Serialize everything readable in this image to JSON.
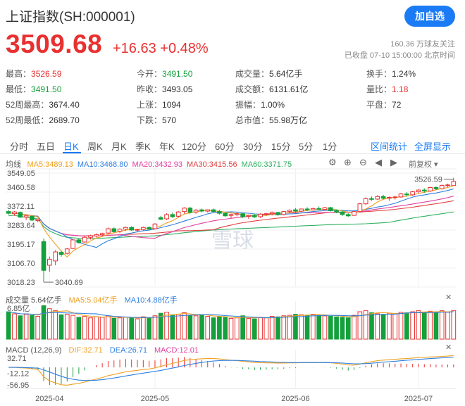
{
  "header": {
    "title": "上证指数(SH:000001)",
    "add_button": "加自选",
    "price": "3509.68",
    "change": "+16.63 +0.48%",
    "followers": "160.36 万球友关注",
    "status": "已收盘 07-10 15:00:00 北京时间"
  },
  "stats": [
    {
      "label": "最高：",
      "value": "3526.59",
      "color": "red"
    },
    {
      "label": "今开：",
      "value": "3491.50",
      "color": "green"
    },
    {
      "label": "成交量：",
      "value": "5.64亿手",
      "color": ""
    },
    {
      "label": "换手：",
      "value": "1.24%",
      "color": ""
    },
    {
      "label": "最低：",
      "value": "3491.50",
      "color": "green"
    },
    {
      "label": "昨收：",
      "value": "3493.05",
      "color": ""
    },
    {
      "label": "成交额：",
      "value": "6131.61亿",
      "color": ""
    },
    {
      "label": "量比：",
      "value": "1.18",
      "color": "red"
    },
    {
      "label": "52周最高：",
      "value": "3674.40",
      "color": ""
    },
    {
      "label": "上涨：",
      "value": "1094",
      "color": ""
    },
    {
      "label": "振幅：",
      "value": "1.00%",
      "color": ""
    },
    {
      "label": "平盘：",
      "value": "72",
      "color": ""
    },
    {
      "label": "52周最低：",
      "value": "2689.70",
      "color": ""
    },
    {
      "label": "下跌：",
      "value": "570",
      "color": ""
    },
    {
      "label": "总市值：",
      "value": "55.98万亿",
      "color": ""
    }
  ],
  "tabs": [
    "分时",
    "五日",
    "日K",
    "周K",
    "月K",
    "季K",
    "年K",
    "120分",
    "60分",
    "30分",
    "15分",
    "5分",
    "1分"
  ],
  "active_tab": "日K",
  "tab_links": [
    "区间统计",
    "全屏显示"
  ],
  "chart_controls": {
    "avg_label": "均线",
    "adjust": "前复权",
    "watermark": "雪球"
  },
  "colors": {
    "up": "#e93030",
    "down": "#14a03c",
    "ma5": "#f0a020",
    "ma10": "#2f7fe0",
    "ma20": "#e040a0",
    "ma30": "#e04040",
    "ma60": "#30b060",
    "accent": "#1a7bf5"
  },
  "ma_legend": [
    {
      "text": "MA5:3489.13",
      "color": "#f0a020"
    },
    {
      "text": "MA10:3468.80",
      "color": "#2f7fe0"
    },
    {
      "text": "MA20:3432.93",
      "color": "#e040a0"
    },
    {
      "text": "MA30:3415.56",
      "color": "#e04040"
    },
    {
      "text": "MA60:3371.75",
      "color": "#30b060"
    }
  ],
  "volume_legend": [
    {
      "text": "成交量 5.64亿手",
      "color": "#555555"
    },
    {
      "text": "MA5:5.04亿手",
      "color": "#f0a020"
    },
    {
      "text": "MA10:4.88亿手",
      "color": "#2f7fe0"
    }
  ],
  "macd_legend": [
    {
      "text": "MACD (12,26,9)",
      "color": "#555555"
    },
    {
      "text": "DIF:32.71",
      "color": "#f0a020"
    },
    {
      "text": "DEA:26.71",
      "color": "#2f7fe0"
    },
    {
      "text": "MACD:12.01",
      "color": "#e040a0"
    }
  ],
  "chart_data": {
    "type": "candlestick",
    "price_axis": {
      "min": 3018.23,
      "max": 3549.05,
      "ticks": [
        "3549.05",
        "3460.58",
        "3372.11",
        "3283.64",
        "3195.17",
        "3106.70",
        "3018.23"
      ]
    },
    "annotations": {
      "high": "3526.59",
      "low": "3040.69"
    },
    "x_labels": [
      {
        "label": "2025-04",
        "index": 7
      },
      {
        "label": "2025-05",
        "index": 25
      },
      {
        "label": "2025-06",
        "index": 49
      },
      {
        "label": "2025-07",
        "index": 70
      }
    ],
    "candles": [
      [
        3370,
        3378,
        3355,
        3362
      ],
      [
        3360,
        3372,
        3350,
        3368
      ],
      [
        3366,
        3370,
        3340,
        3344
      ],
      [
        3344,
        3352,
        3330,
        3350
      ],
      [
        3348,
        3350,
        3325,
        3330
      ],
      [
        3328,
        3336,
        3320,
        3334
      ],
      [
        3230,
        3245,
        3041,
        3096
      ],
      [
        3120,
        3160,
        3090,
        3148
      ],
      [
        3140,
        3190,
        3120,
        3182
      ],
      [
        3180,
        3188,
        3160,
        3170
      ],
      [
        3175,
        3200,
        3170,
        3196
      ],
      [
        3198,
        3240,
        3195,
        3238
      ],
      [
        3238,
        3245,
        3220,
        3226
      ],
      [
        3228,
        3256,
        3225,
        3250
      ],
      [
        3250,
        3262,
        3240,
        3258
      ],
      [
        3256,
        3268,
        3250,
        3262
      ],
      [
        3262,
        3272,
        3255,
        3268
      ],
      [
        3270,
        3295,
        3265,
        3290
      ],
      [
        3290,
        3296,
        3272,
        3276
      ],
      [
        3278,
        3292,
        3270,
        3288
      ],
      [
        3288,
        3300,
        3280,
        3296
      ],
      [
        3296,
        3302,
        3280,
        3284
      ],
      [
        3284,
        3290,
        3275,
        3286
      ],
      [
        3286,
        3300,
        3282,
        3296
      ],
      [
        3296,
        3300,
        3282,
        3288
      ],
      [
        3290,
        3316,
        3288,
        3312
      ],
      [
        3342,
        3350,
        3330,
        3334
      ],
      [
        3336,
        3362,
        3330,
        3356
      ],
      [
        3356,
        3366,
        3340,
        3346
      ],
      [
        3348,
        3372,
        3342,
        3368
      ],
      [
        3370,
        3390,
        3360,
        3386
      ],
      [
        3386,
        3392,
        3360,
        3366
      ],
      [
        3368,
        3382,
        3360,
        3376
      ],
      [
        3378,
        3384,
        3366,
        3372
      ],
      [
        3372,
        3380,
        3366,
        3378
      ],
      [
        3378,
        3384,
        3366,
        3370
      ],
      [
        3370,
        3378,
        3356,
        3362
      ],
      [
        3362,
        3366,
        3345,
        3350
      ],
      [
        3352,
        3360,
        3340,
        3356
      ],
      [
        3356,
        3366,
        3348,
        3360
      ],
      [
        3360,
        3364,
        3340,
        3346
      ],
      [
        3348,
        3356,
        3336,
        3352
      ],
      [
        3352,
        3360,
        3340,
        3345
      ],
      [
        3346,
        3362,
        3340,
        3358
      ],
      [
        3358,
        3364,
        3350,
        3360
      ],
      [
        3360,
        3370,
        3352,
        3366
      ],
      [
        3366,
        3368,
        3350,
        3356
      ],
      [
        3356,
        3372,
        3352,
        3370
      ],
      [
        3370,
        3380,
        3364,
        3376
      ],
      [
        3378,
        3386,
        3366,
        3372
      ],
      [
        3372,
        3384,
        3368,
        3382
      ],
      [
        3382,
        3390,
        3372,
        3378
      ],
      [
        3378,
        3388,
        3374,
        3384
      ],
      [
        3384,
        3394,
        3378,
        3380
      ],
      [
        3380,
        3392,
        3374,
        3388
      ],
      [
        3388,
        3392,
        3370,
        3374
      ],
      [
        3374,
        3380,
        3362,
        3368
      ],
      [
        3368,
        3374,
        3350,
        3356
      ],
      [
        3356,
        3362,
        3345,
        3350
      ],
      [
        3352,
        3372,
        3350,
        3370
      ],
      [
        3370,
        3410,
        3368,
        3406
      ],
      [
        3406,
        3436,
        3400,
        3430
      ],
      [
        3430,
        3440,
        3420,
        3428
      ],
      [
        3428,
        3446,
        3424,
        3440
      ],
      [
        3440,
        3448,
        3426,
        3432
      ],
      [
        3432,
        3440,
        3420,
        3436
      ],
      [
        3436,
        3444,
        3426,
        3438
      ],
      [
        3438,
        3456,
        3434,
        3452
      ],
      [
        3452,
        3460,
        3440,
        3448
      ],
      [
        3448,
        3466,
        3444,
        3462
      ],
      [
        3462,
        3474,
        3456,
        3470
      ],
      [
        3470,
        3478,
        3458,
        3466
      ],
      [
        3466,
        3486,
        3462,
        3482
      ],
      [
        3482,
        3488,
        3470,
        3476
      ],
      [
        3476,
        3496,
        3472,
        3492
      ],
      [
        3492,
        3500,
        3484,
        3494
      ],
      [
        3491,
        3527,
        3491,
        3510
      ]
    ],
    "volume_axis": {
      "max_label": "6.85亿"
    },
    "volumes": [
      5.4,
      5.0,
      4.6,
      4.9,
      4.7,
      4.5,
      6.6,
      6.0,
      5.6,
      4.8,
      4.9,
      4.7,
      4.3,
      4.5,
      4.2,
      4.4,
      4.3,
      4.6,
      4.1,
      4.2,
      4.3,
      4.2,
      4.0,
      4.4,
      4.2,
      4.6,
      5.1,
      5.3,
      4.8,
      4.9,
      5.2,
      4.7,
      4.6,
      4.8,
      4.5,
      4.2,
      4.4,
      4.3,
      4.1,
      4.2,
      4.6,
      4.1,
      4.0,
      4.3,
      4.2,
      4.5,
      4.4,
      4.6,
      4.7,
      4.9,
      4.8,
      4.7,
      4.9,
      4.8,
      4.6,
      4.5,
      4.4,
      4.3,
      4.2,
      4.7,
      5.4,
      5.6,
      5.2,
      5.0,
      4.9,
      5.1,
      5.0,
      5.3,
      5.2,
      5.4,
      5.6,
      5.3,
      5.5,
      5.2,
      5.6,
      5.3,
      5.64
    ],
    "macd_axis": {
      "top": "32.71",
      "mid": "-12.12",
      "bottom": "-56.95"
    }
  }
}
